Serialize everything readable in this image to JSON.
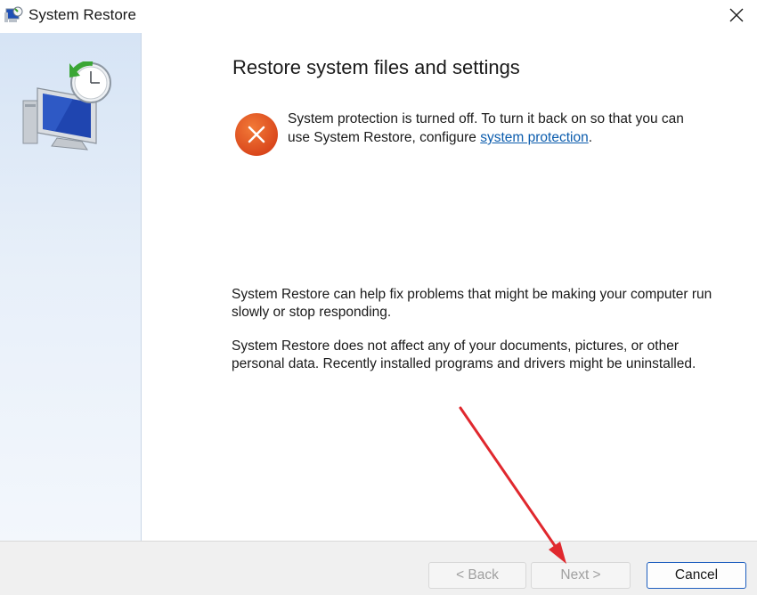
{
  "window": {
    "title": "System Restore",
    "close_icon": "close-icon",
    "app_icon": "system-restore-icon"
  },
  "page": {
    "heading": "Restore system files and settings",
    "error": {
      "icon": "error-x-icon",
      "icon_color": "#e05a1e",
      "text_before": "System protection is turned off. To turn it back on so that you can use System Restore, configure ",
      "link": "system protection",
      "text_after": "."
    },
    "paragraph_1": "System Restore can help fix problems that might be making your computer run slowly or stop responding.",
    "paragraph_2": "System Restore does not affect any of your documents, pictures, or other personal data. Recently installed programs and drivers might be uninstalled."
  },
  "sidebar": {
    "illustration": "computer-clock-restore-icon"
  },
  "buttons": {
    "back": {
      "label": "< Back",
      "enabled": false
    },
    "next": {
      "label": "Next >",
      "enabled": false
    },
    "cancel": {
      "label": "Cancel",
      "enabled": true
    }
  },
  "annotation": {
    "type": "arrow",
    "color": "#e0282e",
    "points_to": "next-button"
  }
}
